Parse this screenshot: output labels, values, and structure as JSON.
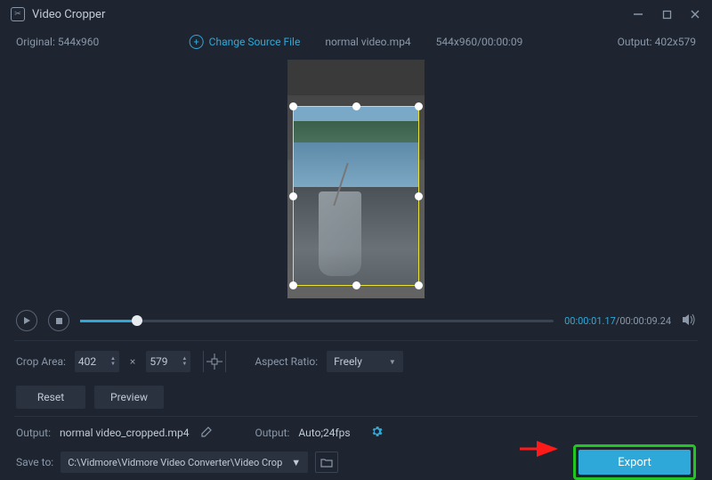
{
  "app": {
    "title": "Video Cropper"
  },
  "infobar": {
    "original_label": "Original:",
    "original_dims": "544x960",
    "change_source_label": "Change Source File",
    "filename": "normal video.mp4",
    "dims_dur": "544x960/00:00:09",
    "output_label": "Output:",
    "output_dims": "402x579"
  },
  "playback": {
    "current_time": "00:00:01.17",
    "total_time": "00:00:09.24"
  },
  "crop": {
    "label": "Crop Area:",
    "width": "402",
    "height": "579",
    "aspect_label": "Aspect Ratio:",
    "aspect_value": "Freely"
  },
  "buttons": {
    "reset": "Reset",
    "preview": "Preview",
    "export": "Export"
  },
  "output": {
    "label1": "Output:",
    "filename": "normal video_cropped.mp4",
    "label2": "Output:",
    "settings": "Auto;24fps"
  },
  "save": {
    "label": "Save to:",
    "path": "C:\\Vidmore\\Vidmore Video Converter\\Video Crop"
  }
}
